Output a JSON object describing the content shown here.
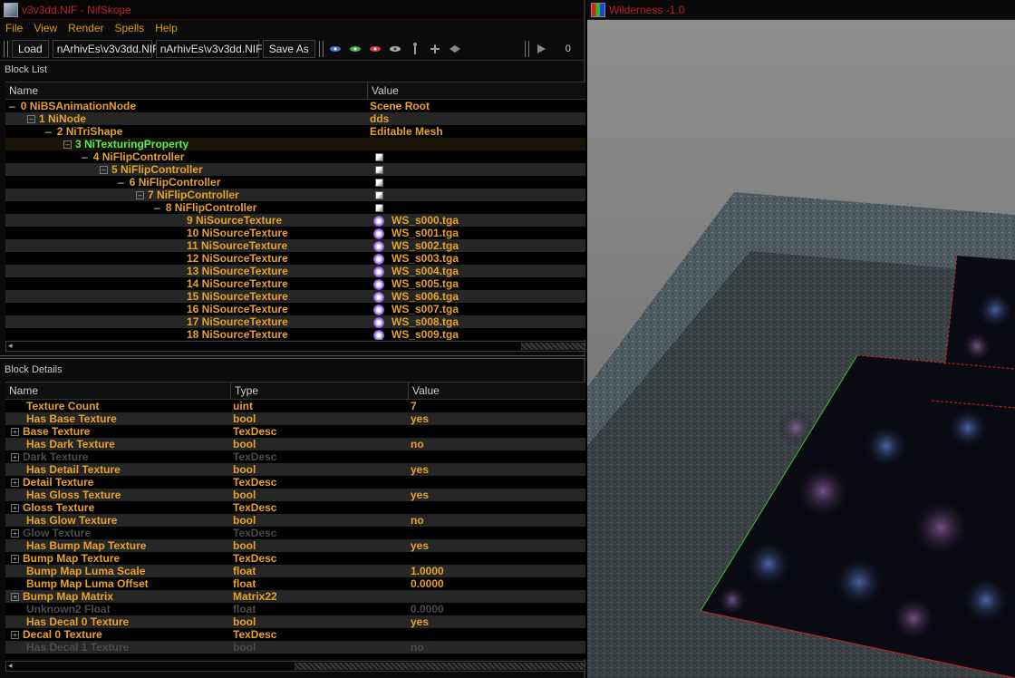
{
  "nifskope": {
    "title": "v3v3dd.NIF - NifSkope",
    "menu": [
      "File",
      "View",
      "Render",
      "Spells",
      "Help"
    ],
    "toolbar": {
      "load_label": "Load",
      "load_path": "nArhivEs\\v3v3dd.NIF",
      "save_path": "nArhivEs\\v3v3dd.NIF",
      "save_as_label": "Save As",
      "frame_number": "0"
    },
    "block_list": {
      "label": "Block List",
      "col_name": "Name",
      "col_value": "Value",
      "rows": [
        {
          "name": "0 NiBSAnimationNode",
          "value": "Scene Root"
        },
        {
          "name": "1 NiNode",
          "value": "dds"
        },
        {
          "name": "2 NiTriShape",
          "value": "Editable Mesh"
        },
        {
          "name": "3 NiTexturingProperty",
          "value": ""
        },
        {
          "name": "4 NiFlipController",
          "value": ""
        },
        {
          "name": "5 NiFlipController",
          "value": ""
        },
        {
          "name": "6 NiFlipController",
          "value": ""
        },
        {
          "name": "7 NiFlipController",
          "value": ""
        },
        {
          "name": "8 NiFlipController",
          "value": ""
        },
        {
          "name": "9 NiSourceTexture",
          "value": "WS_s000.tga"
        },
        {
          "name": "10 NiSourceTexture",
          "value": "WS_s001.tga"
        },
        {
          "name": "11 NiSourceTexture",
          "value": "WS_s002.tga"
        },
        {
          "name": "12 NiSourceTexture",
          "value": "WS_s003.tga"
        },
        {
          "name": "13 NiSourceTexture",
          "value": "WS_s004.tga"
        },
        {
          "name": "14 NiSourceTexture",
          "value": "WS_s005.tga"
        },
        {
          "name": "15 NiSourceTexture",
          "value": "WS_s006.tga"
        },
        {
          "name": "16 NiSourceTexture",
          "value": "WS_s007.tga"
        },
        {
          "name": "17 NiSourceTexture",
          "value": "WS_s008.tga"
        },
        {
          "name": "18 NiSourceTexture",
          "value": "WS_s009.tga"
        }
      ]
    },
    "block_details": {
      "label": "Block Details",
      "col_name": "Name",
      "col_type": "Type",
      "col_value": "Value",
      "rows": [
        {
          "name": "Texture Count",
          "type": "uint",
          "value": "7",
          "active": true
        },
        {
          "name": "Has Base Texture",
          "type": "bool",
          "value": "yes",
          "active": true
        },
        {
          "name": "Base Texture",
          "type": "TexDesc",
          "value": "",
          "active": true
        },
        {
          "name": "Has Dark Texture",
          "type": "bool",
          "value": "no",
          "active": true
        },
        {
          "name": "Dark Texture",
          "type": "TexDesc",
          "value": "",
          "active": false
        },
        {
          "name": "Has Detail Texture",
          "type": "bool",
          "value": "yes",
          "active": true
        },
        {
          "name": "Detail Texture",
          "type": "TexDesc",
          "value": "",
          "active": true
        },
        {
          "name": "Has Gloss Texture",
          "type": "bool",
          "value": "yes",
          "active": true
        },
        {
          "name": "Gloss Texture",
          "type": "TexDesc",
          "value": "",
          "active": true
        },
        {
          "name": "Has Glow Texture",
          "type": "bool",
          "value": "no",
          "active": true
        },
        {
          "name": "Glow Texture",
          "type": "TexDesc",
          "value": "",
          "active": false
        },
        {
          "name": "Has Bump Map Texture",
          "type": "bool",
          "value": "yes",
          "active": true
        },
        {
          "name": "Bump Map Texture",
          "type": "TexDesc",
          "value": "",
          "active": true
        },
        {
          "name": "Bump Map Luma Scale",
          "type": "float",
          "value": "1.0000",
          "active": true
        },
        {
          "name": "Bump Map Luma Offset",
          "type": "float",
          "value": "0.0000",
          "active": true
        },
        {
          "name": "Bump Map Matrix",
          "type": "Matrix22",
          "value": "",
          "active": true
        },
        {
          "name": "Unknown2 Float",
          "type": "float",
          "value": "0.0000",
          "active": false
        },
        {
          "name": "Has Decal 0 Texture",
          "type": "bool",
          "value": "yes",
          "active": true
        },
        {
          "name": "Decal 0 Texture",
          "type": "TexDesc",
          "value": "",
          "active": true
        },
        {
          "name": "Has Decal 1 Texture",
          "type": "bool",
          "value": "no",
          "active": false
        }
      ]
    }
  },
  "wilderness": {
    "title": "Wilderness -1.0"
  }
}
